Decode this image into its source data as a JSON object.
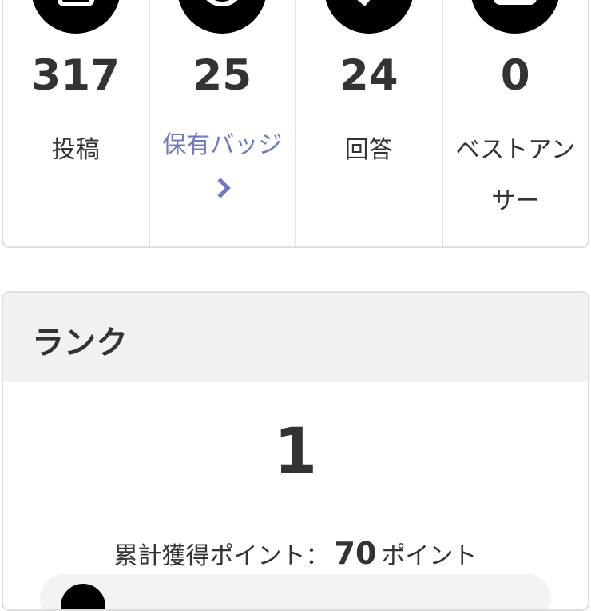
{
  "stats": [
    {
      "icon": "post-icon",
      "value": "317",
      "label": "投稿",
      "link": false
    },
    {
      "icon": "badge-icon",
      "value": "25",
      "label": "保有バッジ",
      "link": true
    },
    {
      "icon": "answer-icon",
      "value": "24",
      "label": "回答",
      "link": false
    },
    {
      "icon": "best-answer-icon",
      "value": "0",
      "label": "ベストアン\nサー",
      "link": false
    }
  ],
  "rank": {
    "title": "ランク",
    "value": "1",
    "points_prefix": "累計獲得ポイント：",
    "points_value": "70",
    "points_suffix": "ポイント"
  },
  "colors": {
    "accent": "#6f79c8",
    "text": "#333333",
    "header_bg": "#f2f1f1"
  }
}
